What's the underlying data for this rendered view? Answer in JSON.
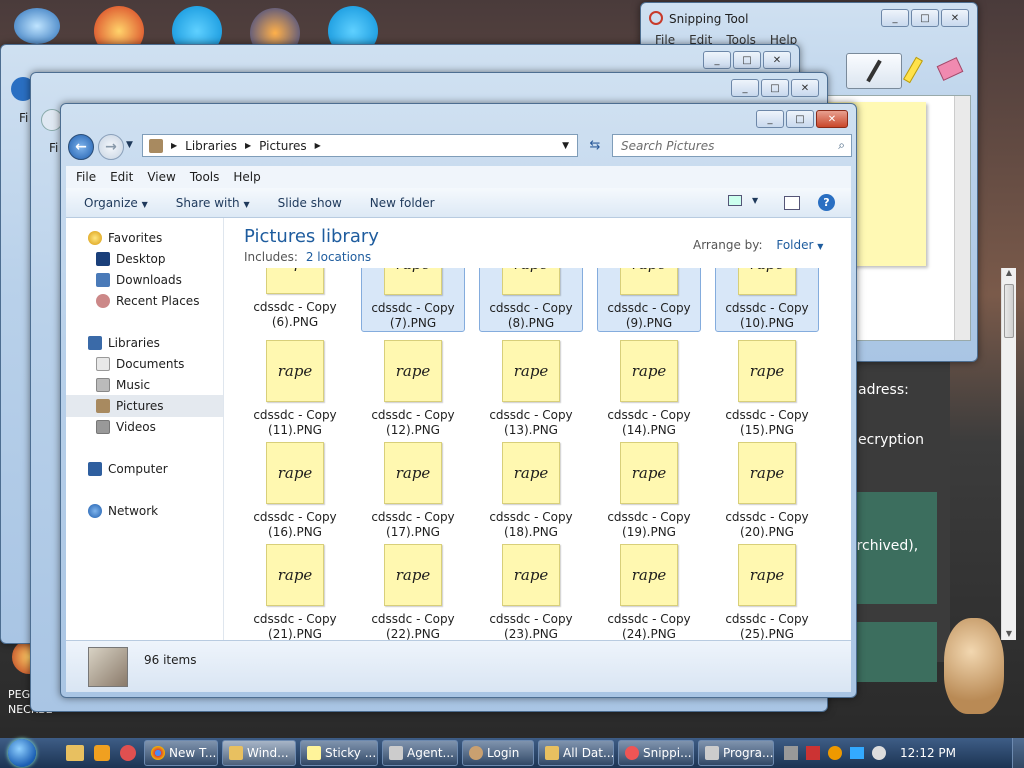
{
  "desktop": {
    "peggle_label": "PEGGLE",
    "neckbe_label": "NECKBE"
  },
  "snipping": {
    "title": "Snipping Tool",
    "menu": [
      "File",
      "Edit",
      "Tools",
      "Help"
    ]
  },
  "background_text": {
    "address": "adress:",
    "decryption": "ecryption",
    "archived": "archived),"
  },
  "explorer": {
    "breadcrumb": [
      "Libraries",
      "Pictures"
    ],
    "search_placeholder": "Search Pictures",
    "menu": [
      "File",
      "Edit",
      "View",
      "Tools",
      "Help"
    ],
    "toolbar": {
      "organize": "Organize",
      "share": "Share with",
      "slideshow": "Slide show",
      "newfolder": "New folder"
    },
    "nav": {
      "favorites": "Favorites",
      "desktop": "Desktop",
      "downloads": "Downloads",
      "recent": "Recent Places",
      "libraries": "Libraries",
      "documents": "Documents",
      "music": "Music",
      "pictures": "Pictures",
      "videos": "Videos",
      "computer": "Computer",
      "network": "Network"
    },
    "library_title": "Pictures library",
    "includes_label": "Includes:",
    "includes_link": "2 locations",
    "arrange_label": "Arrange by:",
    "arrange_value": "Folder",
    "note_text": "rape",
    "tiles": [
      {
        "l1": "cdssdc - Copy",
        "l2": "(6).PNG"
      },
      {
        "l1": "cdssdc - Copy",
        "l2": "(7).PNG"
      },
      {
        "l1": "cdssdc - Copy",
        "l2": "(8).PNG"
      },
      {
        "l1": "cdssdc - Copy",
        "l2": "(9).PNG"
      },
      {
        "l1": "cdssdc - Copy",
        "l2": "(10).PNG"
      },
      {
        "l1": "cdssdc - Copy",
        "l2": "(11).PNG"
      },
      {
        "l1": "cdssdc - Copy",
        "l2": "(12).PNG"
      },
      {
        "l1": "cdssdc - Copy",
        "l2": "(13).PNG"
      },
      {
        "l1": "cdssdc - Copy",
        "l2": "(14).PNG"
      },
      {
        "l1": "cdssdc - Copy",
        "l2": "(15).PNG"
      },
      {
        "l1": "cdssdc - Copy",
        "l2": "(16).PNG"
      },
      {
        "l1": "cdssdc - Copy",
        "l2": "(17).PNG"
      },
      {
        "l1": "cdssdc - Copy",
        "l2": "(18).PNG"
      },
      {
        "l1": "cdssdc - Copy",
        "l2": "(19).PNG"
      },
      {
        "l1": "cdssdc - Copy",
        "l2": "(20).PNG"
      },
      {
        "l1": "cdssdc - Copy",
        "l2": "(21).PNG"
      },
      {
        "l1": "cdssdc - Copy",
        "l2": "(22).PNG"
      },
      {
        "l1": "cdssdc - Copy",
        "l2": "(23).PNG"
      },
      {
        "l1": "cdssdc - Copy",
        "l2": "(24).PNG"
      },
      {
        "l1": "cdssdc - Copy",
        "l2": "(25).PNG"
      }
    ],
    "status": "96 items"
  },
  "taskbar": {
    "items": [
      "New T...",
      "Wind...",
      "Sticky ...",
      "Agent...",
      "Login",
      "All Dat...",
      "Snippi...",
      "Progra..."
    ],
    "clock": "12:12 PM"
  }
}
